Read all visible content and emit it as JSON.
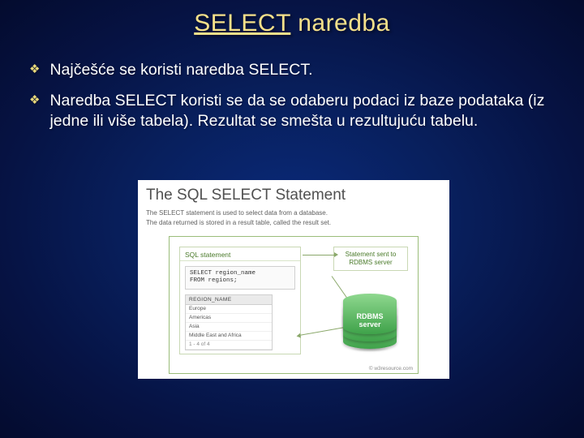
{
  "title": {
    "select": "SELECT",
    "rest": " naredba"
  },
  "bullets": [
    "Najčešće se koristi naredba SELECT.",
    "Naredba SELECT koristi se da se odaberu podaci iz baze podataka (iz jedne ili više tabela). Rezultat se smešta u rezultujuću tabelu."
  ],
  "figure": {
    "heading": "The SQL SELECT Statement",
    "p1": "The SELECT statement is used to select data from a database.",
    "p2": "The data returned is stored in a result table, called the result set.",
    "sql_box_title": "SQL statement",
    "sql_code_l1": "SELECT region_name",
    "sql_code_l2": "FROM regions;",
    "result_header": "REGION_NAME",
    "result_rows": [
      "Europe",
      "Americas",
      "Asia",
      "Middle East and Africa"
    ],
    "result_footer": "1 - 4 of 4",
    "right_box_l1": "Statement sent to",
    "right_box_l2": "RDBMS server",
    "db_label_l1": "RDBMS",
    "db_label_l2": "server",
    "credit": "© w3resource.com"
  }
}
